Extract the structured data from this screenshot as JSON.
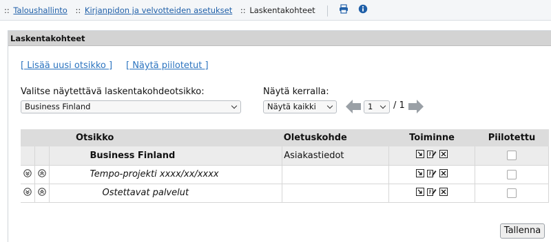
{
  "breadcrumb": {
    "prefix": "::",
    "items": [
      "Taloushallinto",
      "Kirjanpidon ja velvotteiden asetukset"
    ],
    "current": "Laskentakohteet",
    "icons": [
      "printer-icon",
      "info-icon"
    ]
  },
  "panel": {
    "title": "Laskentakohteet"
  },
  "links": {
    "add_new": "[ Lisää uusi otsikko ]",
    "show_hidden": "[ Näytä piilotetut ]"
  },
  "selector": {
    "label": "Valitse näytettävä laskentakohdeotsikko:",
    "value": "Business Finland"
  },
  "paging": {
    "label": "Näytä kerralla:",
    "per_page": "Näytä kaikki",
    "page": "1",
    "total": "/ 1"
  },
  "table": {
    "headers": [
      "Otsikko",
      "Oletuskohde",
      "Toiminne",
      "Piilotettu"
    ],
    "rows": [
      {
        "title": "Business Finland",
        "default_target": "Asiakastiedot",
        "style": "bold",
        "hidden": false
      },
      {
        "title": "Tempo-projekti xxxx/xx/xxxx",
        "default_target": "",
        "style": "italic",
        "hidden": false
      },
      {
        "title": "Ostettavat palvelut",
        "default_target": "",
        "style": "italic-indent",
        "hidden": false
      }
    ]
  },
  "save_label": "Tallenna",
  "colors": {
    "link": "#2a73bf",
    "header_bg": "#dcdcdc",
    "panel_head_bg": "#d3d3d3",
    "arrow": "#9aa0a6"
  }
}
